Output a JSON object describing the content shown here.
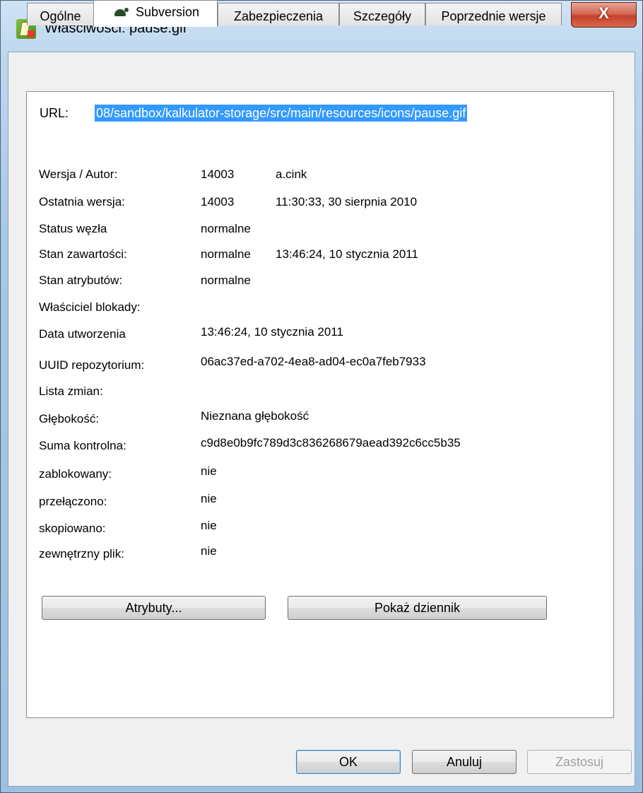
{
  "window": {
    "title": "Właściwości: pause.gif",
    "close_label": "X"
  },
  "tabs": [
    {
      "label": "Ogólne"
    },
    {
      "label": "Subversion",
      "icon": "turtle-icon"
    },
    {
      "label": "Zabezpieczenia"
    },
    {
      "label": "Szczegóły"
    },
    {
      "label": "Poprzednie wersje"
    }
  ],
  "url": {
    "label": "URL:",
    "value": "08/sandbox/kalkulator-storage/src/main/resources/icons/pause.gif"
  },
  "props": [
    {
      "label": "Wersja / Autor:",
      "value": "14003",
      "extra": "a.cink"
    },
    {
      "label": "Ostatnia wersja:",
      "value": "14003",
      "extra": "11:30:33, 30 sierpnia 2010"
    },
    {
      "label": "Status węzła",
      "value": "normalne",
      "extra": ""
    },
    {
      "label": "Stan zawartości:",
      "value": "normalne",
      "extra": "13:46:24, 10 stycznia 2011"
    },
    {
      "label": "Stan atrybutów:",
      "value": "normalne",
      "extra": ""
    },
    {
      "label": "Właściciel blokady:",
      "value": "",
      "extra": ""
    },
    {
      "label": "Data utworzenia",
      "value": "13:46:24, 10 stycznia 2011",
      "extra": ""
    },
    {
      "label": "UUID repozytorium:",
      "value": "06ac37ed-a702-4ea8-ad04-ec0a7feb7933",
      "extra": ""
    },
    {
      "label": "Lista zmian:",
      "value": "",
      "extra": ""
    },
    {
      "label": "Głębokość:",
      "value": "Nieznana głębokość",
      "extra": ""
    },
    {
      "label": "Suma kontrolna:",
      "value": "c9d8e0b9fc789d3c836268679aead392c6cc5b35",
      "extra": ""
    },
    {
      "label": "zablokowany:",
      "value": "nie",
      "extra": ""
    },
    {
      "label": "przełączono:",
      "value": "nie",
      "extra": ""
    },
    {
      "label": "skopiowano:",
      "value": "nie",
      "extra": ""
    },
    {
      "label": "zewnętrzny plik:",
      "value": "nie",
      "extra": ""
    }
  ],
  "actions": {
    "attributes": "Atrybuty...",
    "show_log": "Pokaż dziennik"
  },
  "footer": {
    "ok": "OK",
    "cancel": "Anuluj",
    "apply": "Zastosuj"
  }
}
